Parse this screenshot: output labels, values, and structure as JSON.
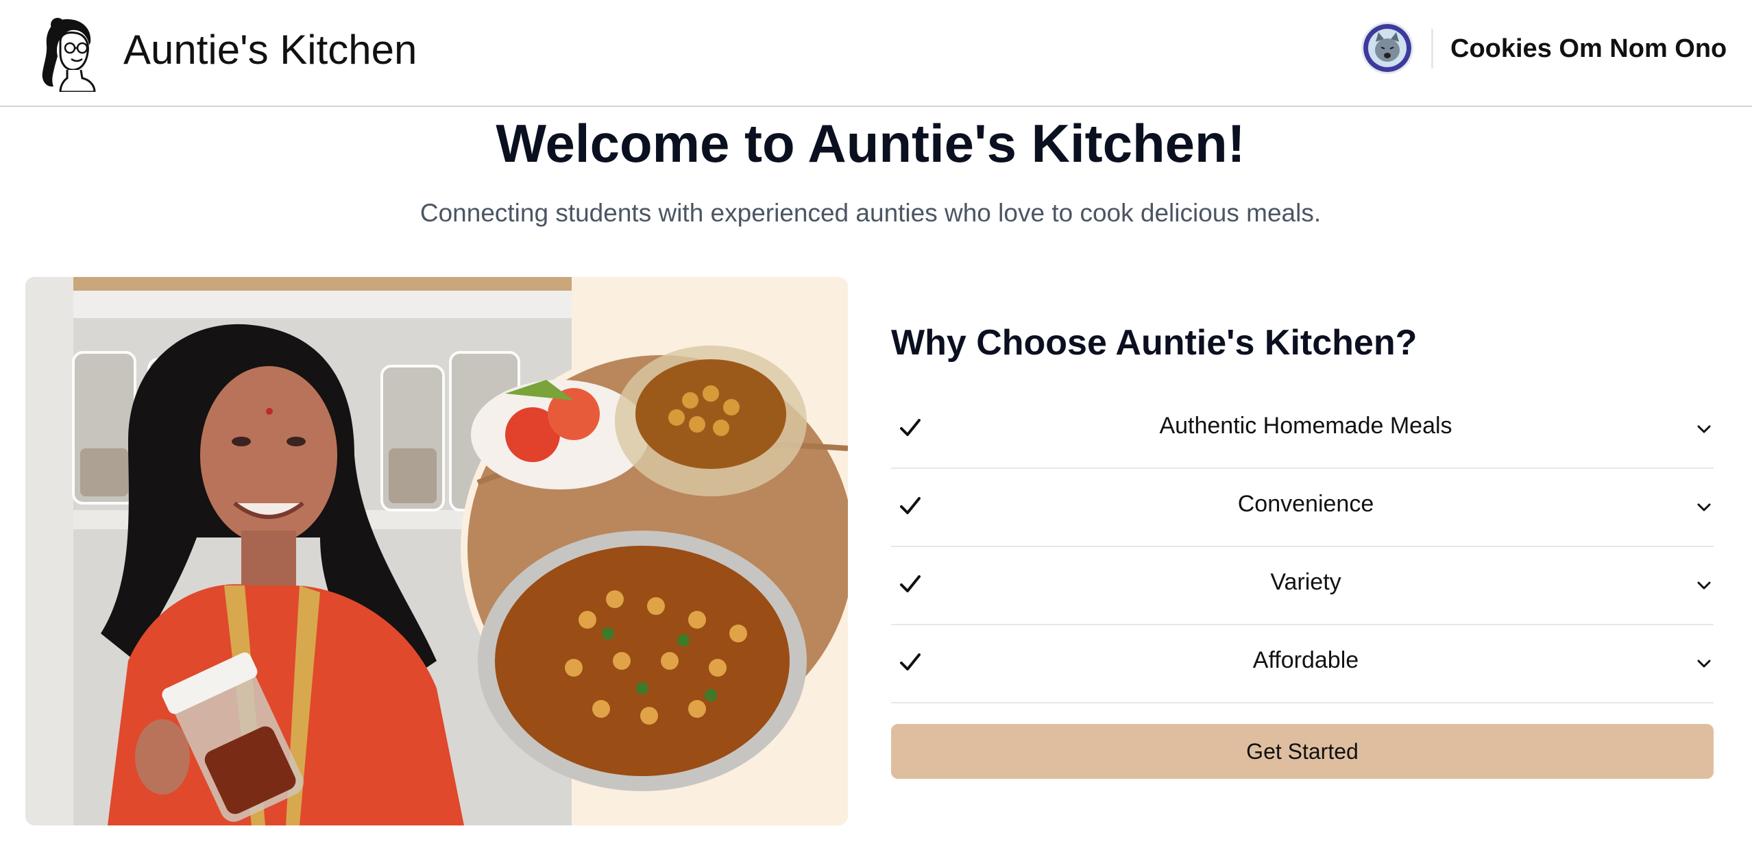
{
  "header": {
    "logo_icon": "auntie-logo-icon",
    "brand_title": "Auntie's Kitchen",
    "avatar_icon": "user-avatar-icon",
    "user_name": "Cookies Om Nom Ono"
  },
  "hero": {
    "title": "Welcome to Auntie's Kitchen!",
    "subtitle": "Connecting students with experienced aunties who love to cook delicious meals."
  },
  "image_panel": {
    "subject": "auntie-with-jar-and-chickpea-curry-photo"
  },
  "why": {
    "title": "Why Choose Auntie's Kitchen?",
    "check_icon": "check-icon",
    "chevron_icon": "chevron-down-icon",
    "features": [
      {
        "label": "Authentic Homemade Meals"
      },
      {
        "label": "Convenience"
      },
      {
        "label": "Variety"
      },
      {
        "label": "Affordable"
      }
    ]
  },
  "cta": {
    "label": "Get Started"
  },
  "colors": {
    "accent": "#dfbea0",
    "panel_background": "#fbefe0",
    "heading": "#0b1020",
    "muted_text": "#4b5563",
    "divider": "#e5e7eb"
  }
}
